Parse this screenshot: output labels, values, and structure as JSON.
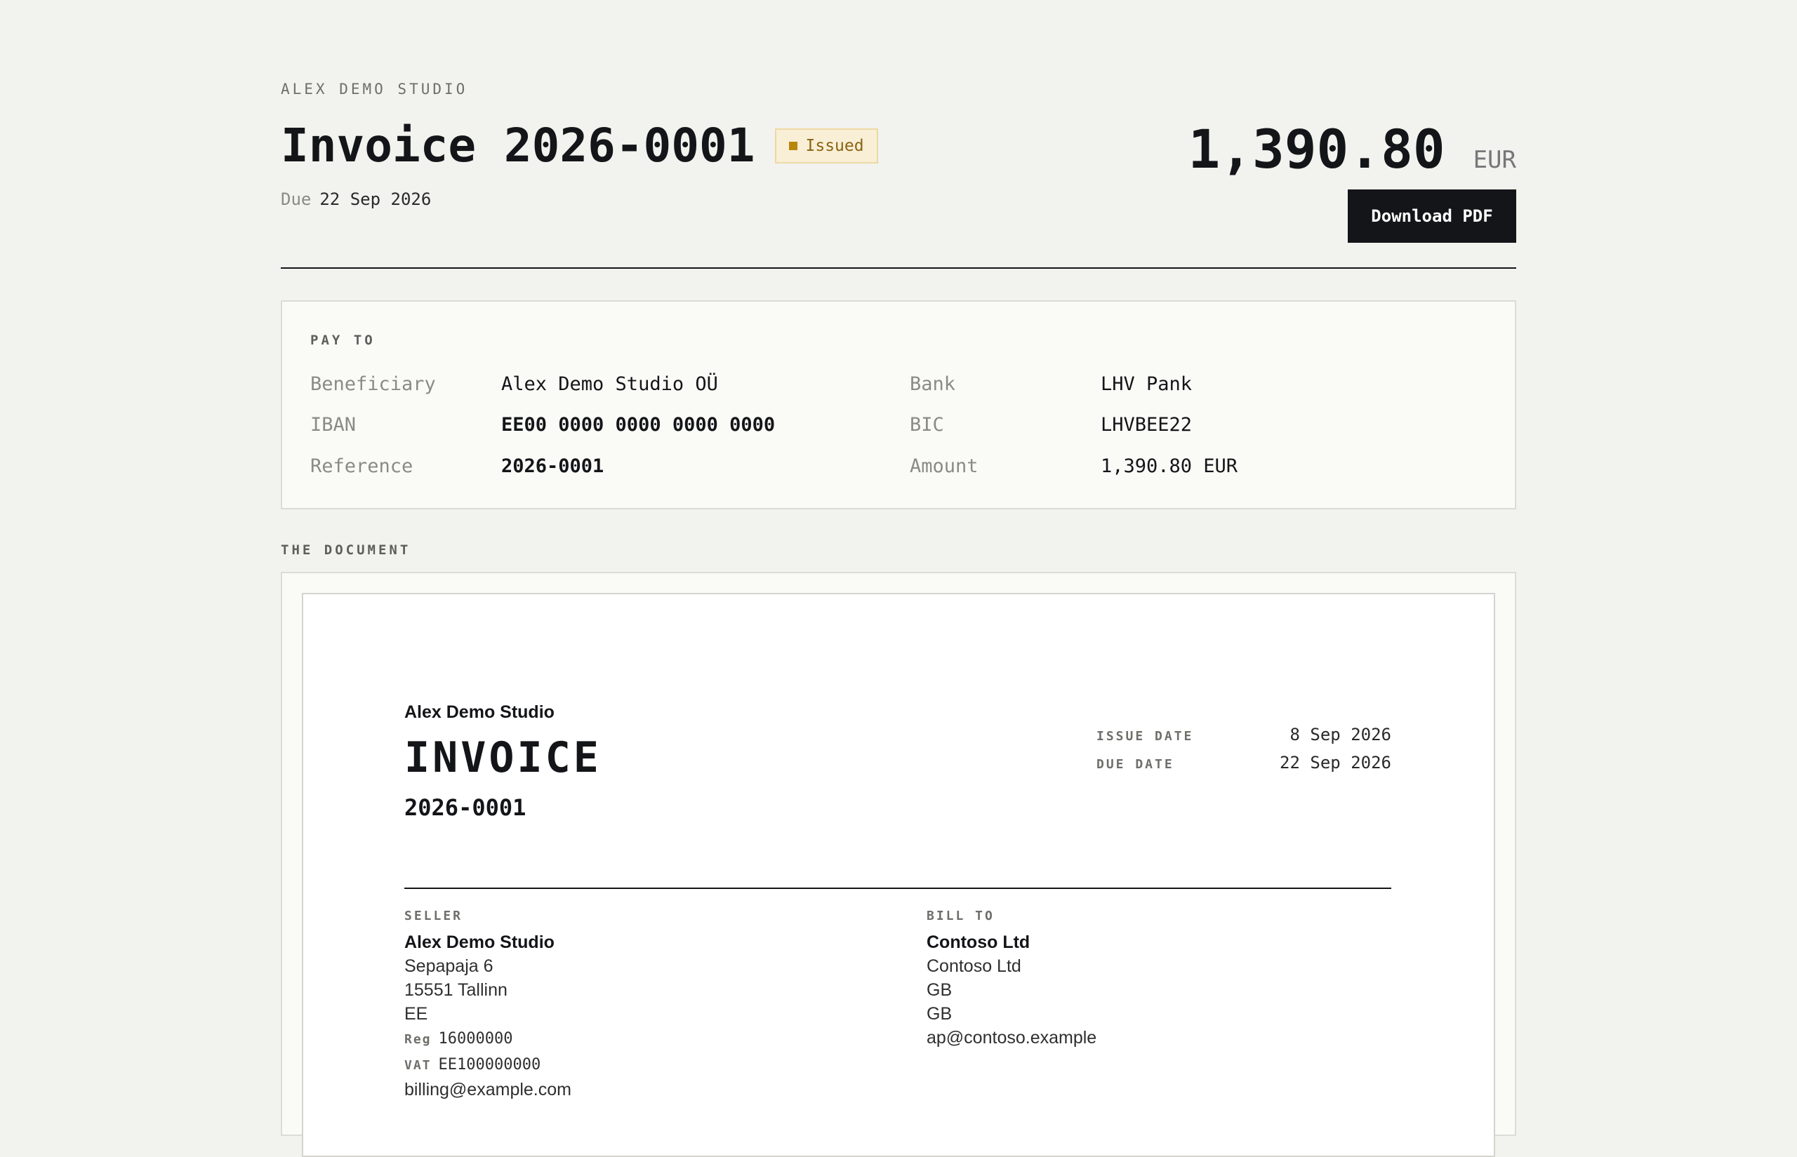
{
  "header": {
    "studio_label": "ALEX DEMO STUDIO",
    "title": "Invoice 2026-0001",
    "status_badge": "Issued",
    "due_label": "Due",
    "due_value": "22 Sep 2026",
    "amount": "1,390.80",
    "currency": "EUR",
    "download_label": "Download PDF"
  },
  "pay_to": {
    "caption": "PAY TO",
    "rows": [
      {
        "label": "Beneficiary",
        "value": "Alex Demo Studio OÜ"
      },
      {
        "label": "IBAN",
        "value": "EE00 0000 0000 0000 0000"
      },
      {
        "label": "Reference",
        "value": "2026-0001"
      },
      {
        "label": "Bank",
        "value": "LHV Pank"
      },
      {
        "label": "BIC",
        "value": "LHVBEE22"
      },
      {
        "label": "Amount",
        "value": "1,390.80 EUR"
      }
    ]
  },
  "document": {
    "caption": "THE DOCUMENT",
    "company": "Alex Demo Studio",
    "title": "INVOICE",
    "number": "2026-0001",
    "issue_date_label": "ISSUE DATE",
    "issue_date": "8 Sep 2026",
    "due_date_label": "DUE DATE",
    "due_date": "22 Sep 2026",
    "seller": {
      "caption": "SELLER",
      "name": "Alex Demo Studio",
      "street": "Sepapaja 6",
      "city": "15551 Tallinn",
      "country": "EE",
      "reg_label": "Reg",
      "reg": "16000000",
      "vat_label": "VAT",
      "vat": "EE100000000",
      "email": "billing@example.com"
    },
    "bill_to": {
      "caption": "BILL TO",
      "name": "Contoso Ltd",
      "line1": "Contoso Ltd",
      "line2": "GB",
      "line3": "GB",
      "email": "ap@contoso.example"
    }
  }
}
